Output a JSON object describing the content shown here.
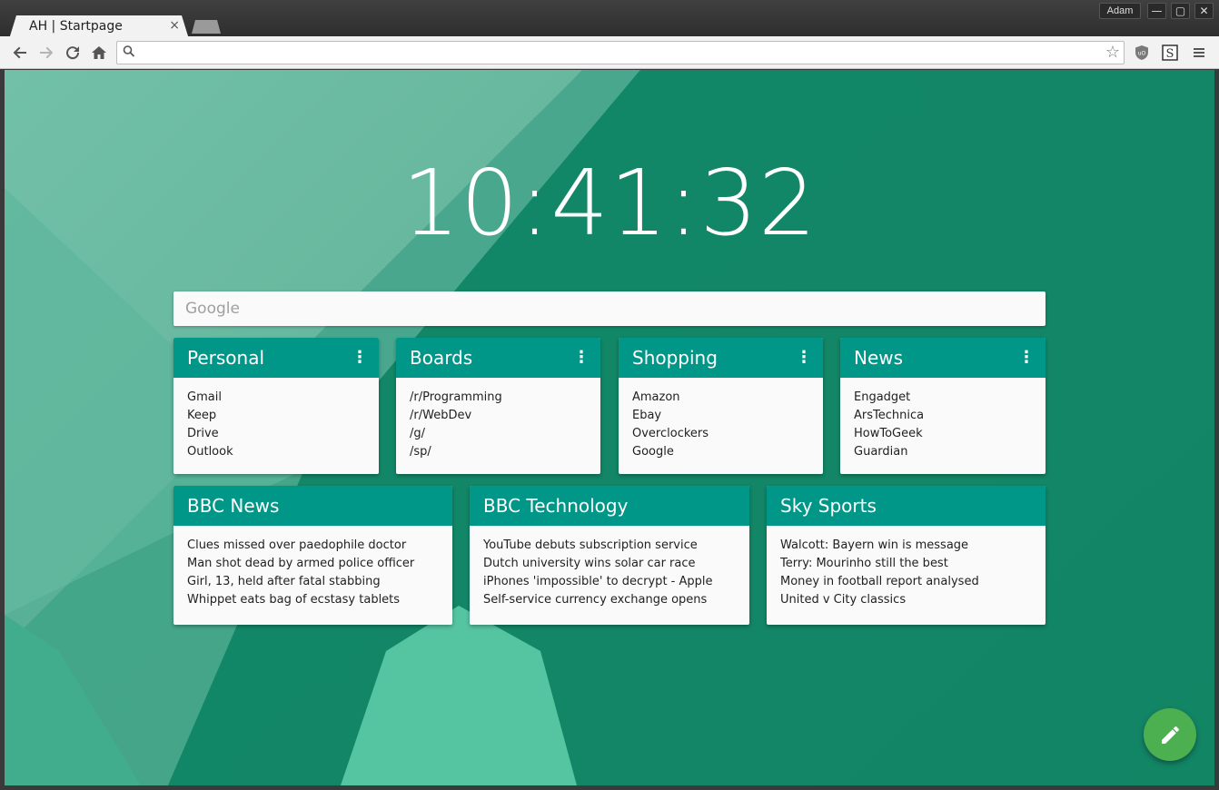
{
  "browser": {
    "tab_title": "AH | Startpage",
    "tab_close": "×",
    "profile_name": "Adam",
    "window_controls": {
      "minimize": "—",
      "maximize": "▢",
      "close": "✕"
    },
    "omnibox_value": "",
    "icons": [
      "back-icon",
      "forward-icon",
      "reload-icon",
      "home-icon",
      "search-icon",
      "star-icon",
      "ublock-icon",
      "stylish-icon",
      "menu-icon"
    ]
  },
  "page": {
    "clock": "10:41:32",
    "search_placeholder": "Google",
    "colors": {
      "card_header": "#009688",
      "fab": "#4caf50",
      "background": "#0a7d5e"
    },
    "link_cards": [
      {
        "title": "Personal",
        "links": [
          "Gmail",
          "Keep",
          "Drive",
          "Outlook"
        ]
      },
      {
        "title": "Boards",
        "links": [
          "/r/Programming",
          "/r/WebDev",
          "/g/",
          "/sp/"
        ]
      },
      {
        "title": "Shopping",
        "links": [
          "Amazon",
          "Ebay",
          "Overclockers",
          "Google"
        ]
      },
      {
        "title": "News",
        "links": [
          "Engadget",
          "ArsTechnica",
          "HowToGeek",
          "Guardian"
        ]
      }
    ],
    "feed_cards": [
      {
        "title": "BBC News",
        "items": [
          "Clues missed over paedophile doctor",
          "Man shot dead by armed police officer",
          "Girl, 13, held after fatal stabbing",
          "Whippet eats bag of ecstasy tablets"
        ]
      },
      {
        "title": "BBC Technology",
        "items": [
          "YouTube debuts subscription service",
          "Dutch university wins solar car race",
          "iPhones 'impossible' to decrypt - Apple",
          "Self-service currency exchange opens"
        ]
      },
      {
        "title": "Sky Sports",
        "items": [
          "Walcott: Bayern win is message",
          "Terry: Mourinho still the best",
          "Money in football report analysed",
          "United v City classics"
        ]
      }
    ],
    "fab_icon": "edit-pencil-icon"
  }
}
